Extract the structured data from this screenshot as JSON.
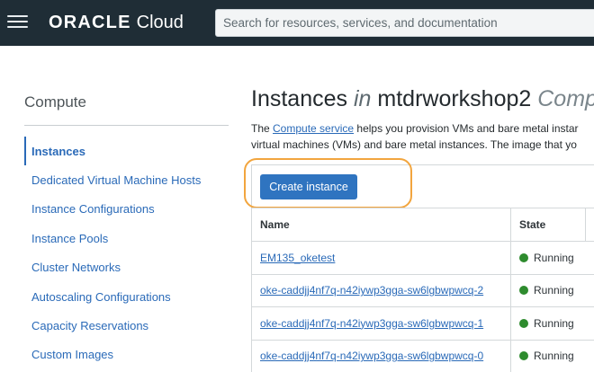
{
  "header": {
    "logo_oracle": "ORACLE",
    "logo_cloud": "Cloud",
    "search_placeholder": "Search for resources, services, and documentation"
  },
  "sidebar": {
    "title": "Compute",
    "items": [
      {
        "label": "Instances",
        "active": true
      },
      {
        "label": "Dedicated Virtual Machine Hosts"
      },
      {
        "label": "Instance Configurations"
      },
      {
        "label": "Instance Pools"
      },
      {
        "label": "Cluster Networks"
      },
      {
        "label": "Autoscaling Configurations"
      },
      {
        "label": "Capacity Reservations"
      },
      {
        "label": "Custom Images"
      }
    ]
  },
  "main": {
    "title": "Instances",
    "title_in": "in",
    "compartment": "mtdrworkshop2",
    "compartment_suffix": "Comp",
    "desc_prefix": "The ",
    "desc_link": "Compute service",
    "desc_line1_rest": " helps you provision VMs and bare metal instar",
    "desc_line2": "virtual machines (VMs) and bare metal instances. The image that yo",
    "create_button": "Create instance",
    "table": {
      "headers": {
        "name": "Name",
        "state": "State"
      },
      "rows": [
        {
          "name": "EM135_oketest",
          "state": "Running"
        },
        {
          "name": "oke-caddjj4nf7q-n42iywp3gga-sw6lgbwpwcq-2",
          "state": "Running"
        },
        {
          "name": "oke-caddjj4nf7q-n42iywp3gga-sw6lgbwpwcq-1",
          "state": "Running"
        },
        {
          "name": "oke-caddjj4nf7q-n42iywp3gga-sw6lgbwpwcq-0",
          "state": "Running"
        }
      ]
    }
  },
  "colors": {
    "topbar": "#1f2d36",
    "link": "#2a6ab8",
    "button": "#2f74c0",
    "highlight": "#f2a53e",
    "running": "#2e8b2e"
  }
}
